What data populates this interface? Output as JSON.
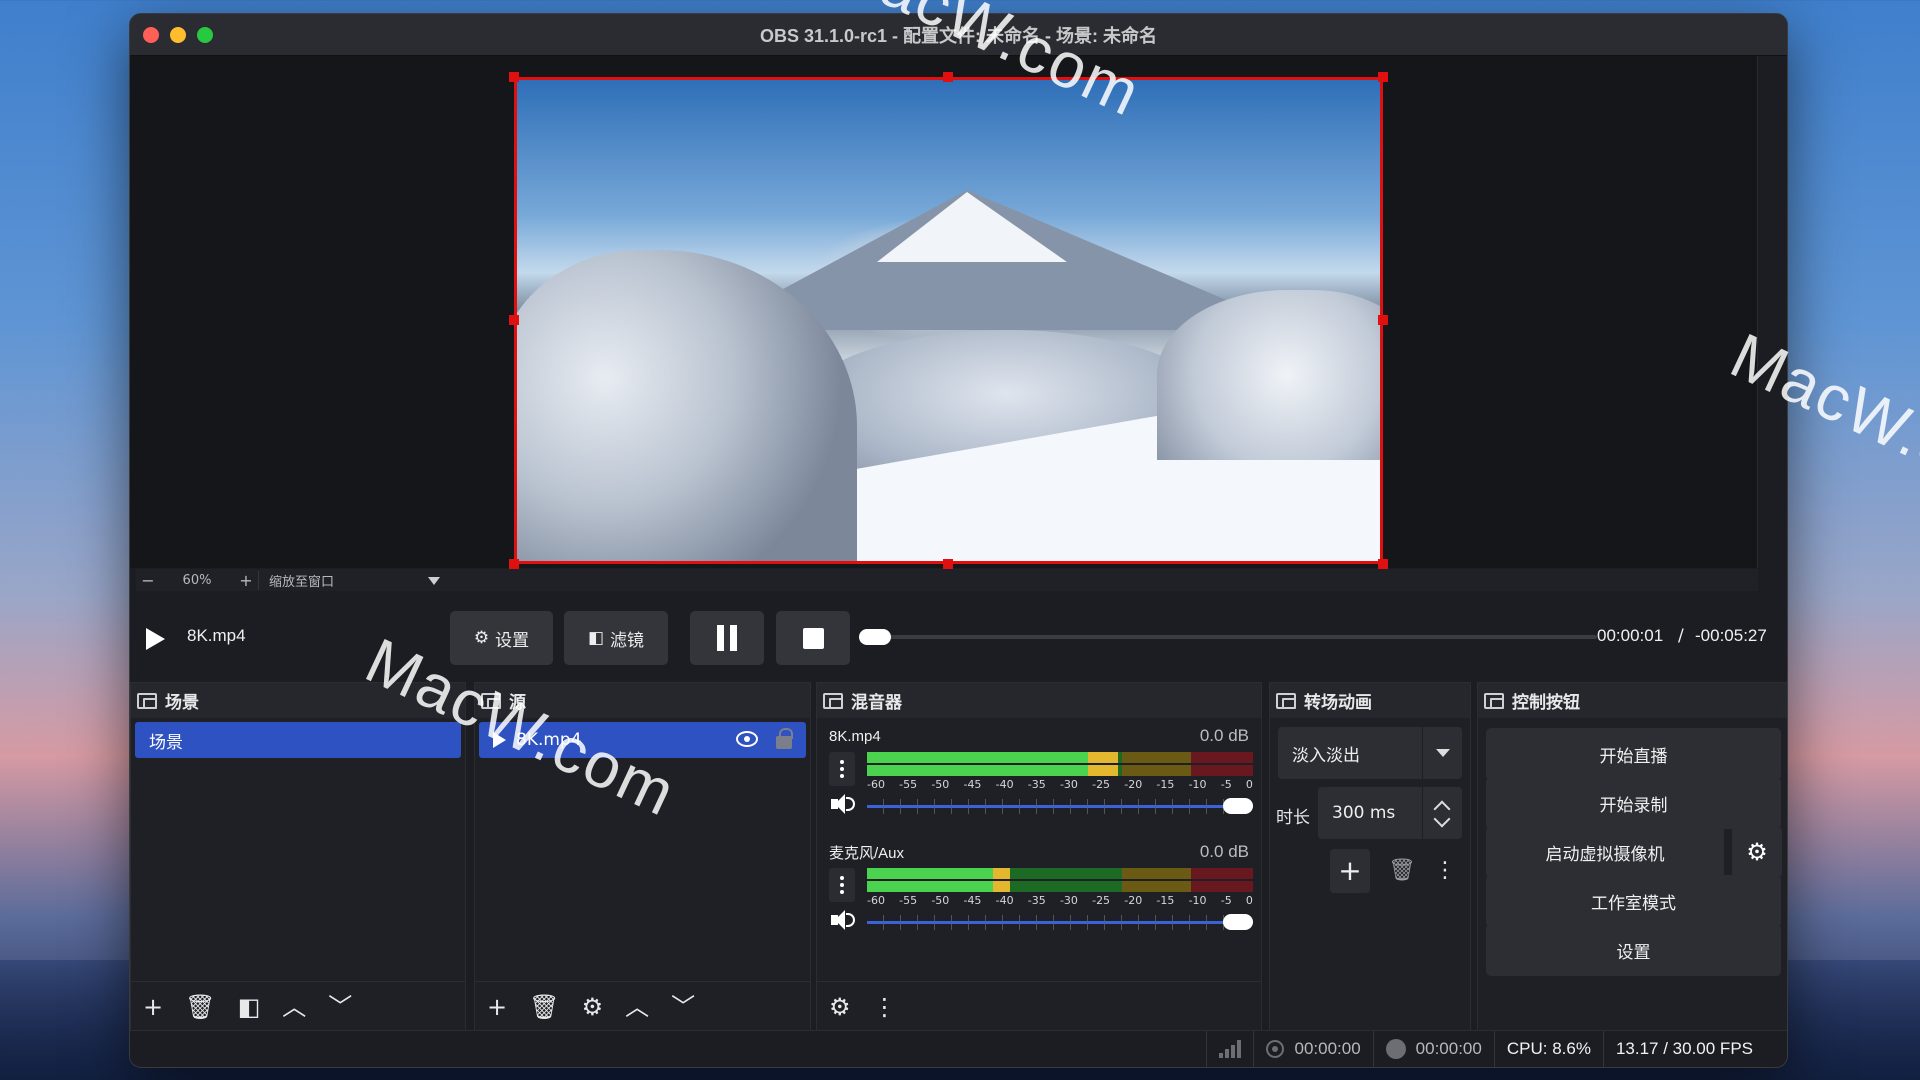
{
  "window": {
    "title": "OBS 31.1.0-rc1 - 配置文件: 未命名 - 场景: 未命名"
  },
  "preview": {
    "zoom_value": "60%",
    "zoom_minus": "−",
    "zoom_plus": "+",
    "zoom_mode": "缩放至窗口"
  },
  "media": {
    "source_name": "8K.mp4",
    "settings_label": "设置",
    "filters_label": "滤镜",
    "time_current": "00:00:01",
    "time_separator": "/",
    "time_remaining": "-00:05:27",
    "progress": 0.003
  },
  "scenes": {
    "title": "场景",
    "items": [
      {
        "label": "场景",
        "selected": true
      }
    ]
  },
  "sources": {
    "title": "源",
    "items": [
      {
        "label": "8K.mp4",
        "visible": true,
        "locked": false
      }
    ]
  },
  "mixer": {
    "title": "混音器",
    "scale": [
      "-60",
      "-55",
      "-50",
      "-45",
      "-40",
      "-35",
      "-30",
      "-25",
      "-20",
      "-15",
      "-10",
      "-5",
      "0"
    ],
    "channels": [
      {
        "name": "8K.mp4",
        "db": "0.0 dB",
        "level": 0.65
      },
      {
        "name": "麦克风/Aux",
        "db": "0.0 dB",
        "level": 0.37
      }
    ]
  },
  "transitions": {
    "title": "转场动画",
    "selected": "淡入淡出",
    "duration_label": "时长",
    "duration_value": "300 ms"
  },
  "controls": {
    "title": "控制按钮",
    "start_stream": "开始直播",
    "start_record": "开始录制",
    "start_vcam": "启动虚拟摄像机",
    "studio_mode": "工作室模式",
    "settings": "设置"
  },
  "status": {
    "stream_time": "00:00:00",
    "record_time": "00:00:00",
    "cpu": "CPU: 8.6%",
    "fps": "13.17 / 30.00 FPS"
  },
  "watermark": "MacW.com",
  "colors": {
    "selection": "#2f52c2",
    "canvas_border": "#e01010",
    "meter_green": "#4bd34f",
    "meter_yellow": "#e3b82f",
    "meter_red": "#6a1820"
  }
}
